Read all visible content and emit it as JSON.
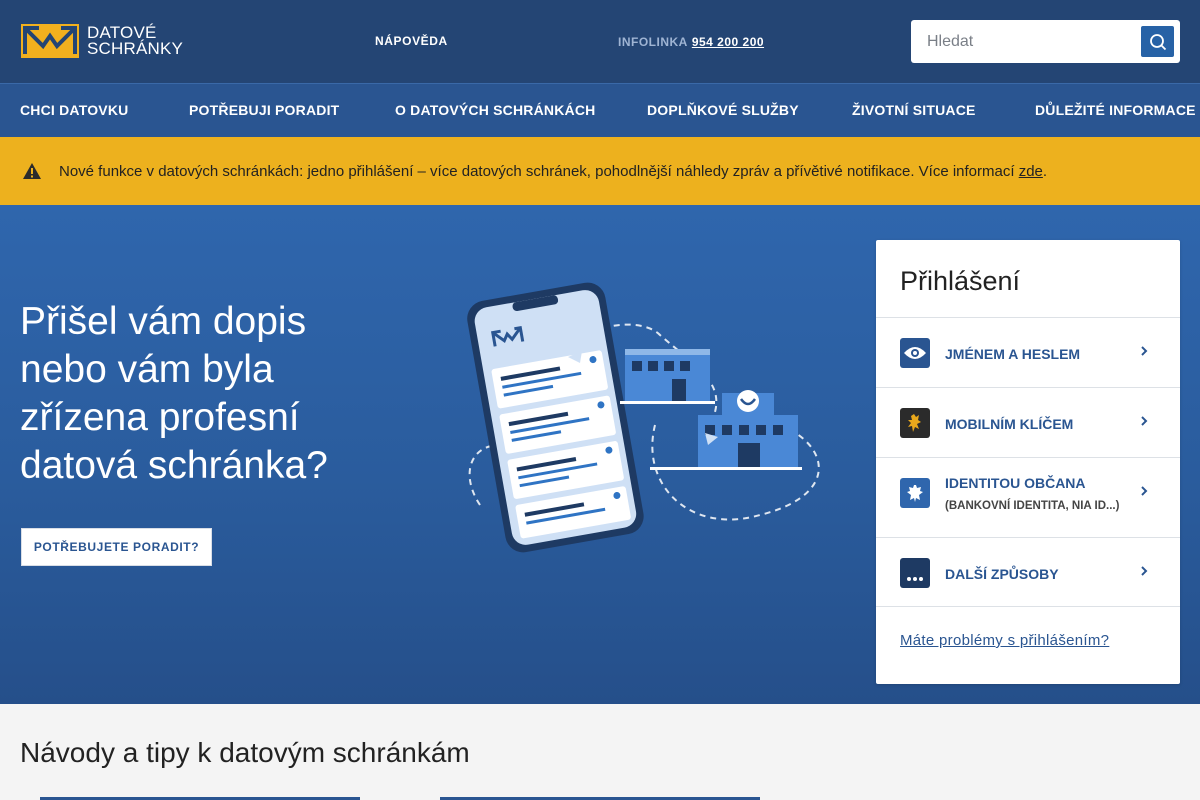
{
  "brand": {
    "line1": "DATOVÉ",
    "line2": "SCHRÁNKY",
    "logo_color": "#f2b01e"
  },
  "header": {
    "help": "NÁPOVĚDA",
    "infoline_label": "INFOLINKA",
    "infoline_phone": "954 200 200",
    "search_placeholder": "Hledat"
  },
  "nav": {
    "items": [
      "CHCI DATOVKU",
      "POTŘEBUJI PORADIT",
      "O DATOVÝCH SCHRÁNKÁCH",
      "DOPLŇKOVÉ SLUŽBY",
      "ŽIVOTNÍ SITUACE",
      "DŮLEŽITÉ INFORMACE"
    ]
  },
  "alert": {
    "text": "Nové funkce v datových schránkách: jedno přihlášení – více datových schránek, pohodlnější náhledy zpráv a přívětivé notifikace. Více informací ",
    "link": "zde",
    "end": ".",
    "color": "#edb11e"
  },
  "hero": {
    "title": "Přišel vám dopis nebo vám byla zřízena profesní datová schránka?",
    "button": "POTŘEBUJETE PORADIT?"
  },
  "login": {
    "title": "Přihlášení",
    "options": [
      {
        "label": "JMÉNEM A HESLEM",
        "sub": "",
        "icon": "eye-icon"
      },
      {
        "label": "MOBILNÍM KLÍČEM",
        "sub": "",
        "icon": "czech-lion-icon"
      },
      {
        "label": "IDENTITOU OBČANA",
        "sub": "(BANKOVNÍ IDENTITA, NIA ID...)",
        "icon": "moravian-eagle-icon"
      },
      {
        "label": "DALŠÍ ZPŮSOBY",
        "sub": "",
        "icon": "more-dots-icon"
      }
    ],
    "problem_link": "Máte problémy s přihlášením?"
  },
  "guides": {
    "title": "Návody a tipy k datovým schránkám"
  }
}
